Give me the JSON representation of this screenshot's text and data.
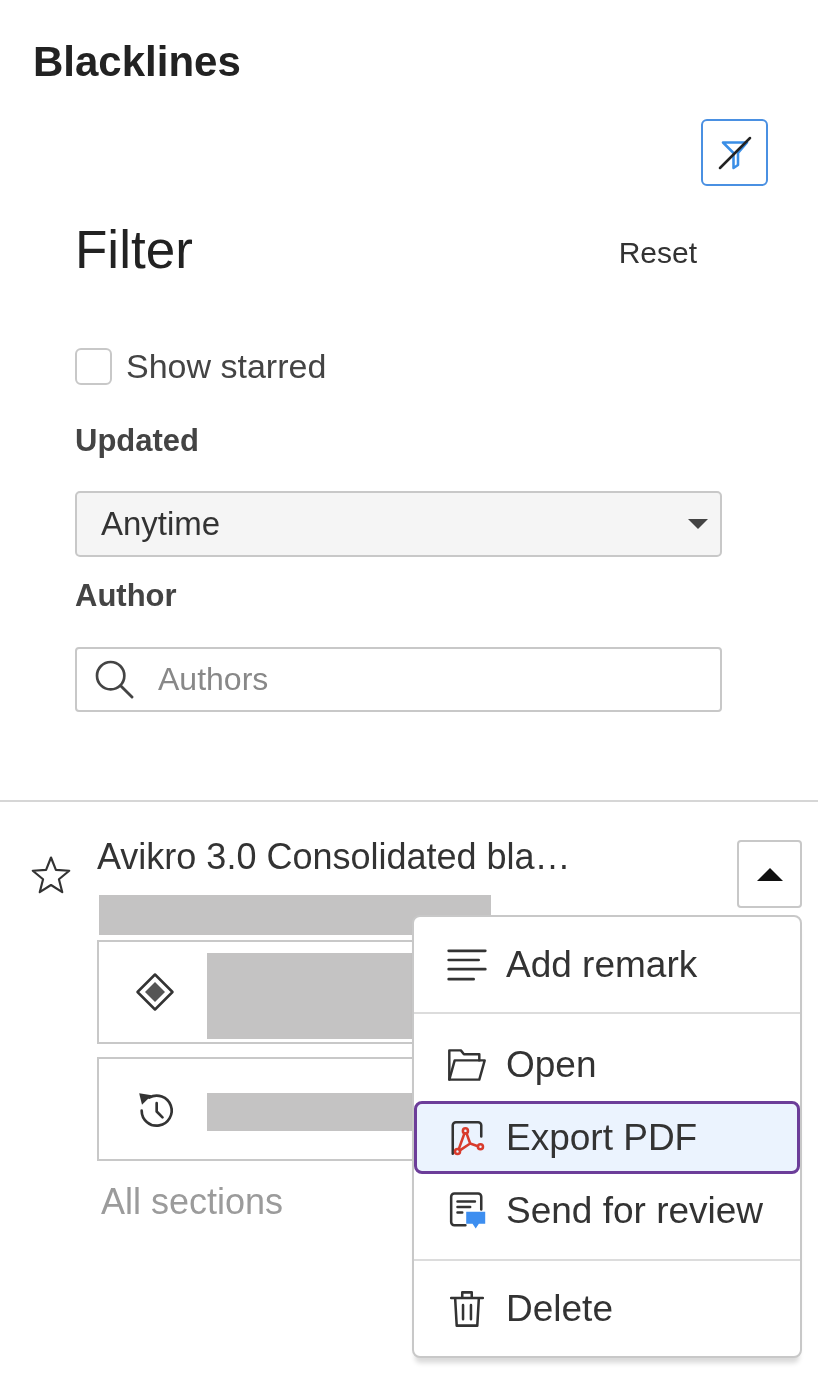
{
  "page": {
    "title": "Blacklines"
  },
  "filter": {
    "heading": "Filter",
    "reset": "Reset",
    "show_starred": {
      "label": "Show starred",
      "checked": false
    },
    "updated": {
      "label": "Updated",
      "value": "Anytime"
    },
    "author": {
      "label": "Author",
      "placeholder": "Authors"
    }
  },
  "document": {
    "title": "Avikro 3.0 Consolidated bla…",
    "starred": false,
    "menu_expanded": true,
    "sections_label": "All sections"
  },
  "menu": {
    "groups": [
      {
        "items": [
          {
            "label": "Add remark",
            "selected": false
          }
        ]
      },
      {
        "items": [
          {
            "label": "Open",
            "selected": false
          },
          {
            "label": "Export PDF",
            "selected": true
          },
          {
            "label": "Send for review",
            "selected": false
          }
        ]
      },
      {
        "items": [
          {
            "label": "Delete",
            "selected": false
          }
        ]
      }
    ]
  }
}
